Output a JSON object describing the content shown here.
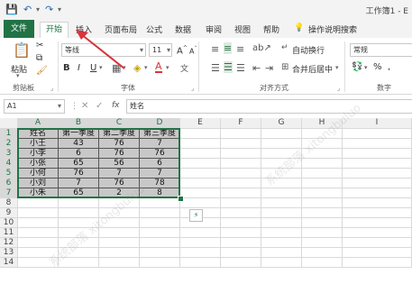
{
  "titlebar": {
    "window_title": "工作簿1 - E"
  },
  "tabs": [
    "文件",
    "开始",
    "插入",
    "页面布局",
    "公式",
    "数据",
    "审阅",
    "视图",
    "帮助"
  ],
  "tell_me": "操作说明搜索",
  "ribbon": {
    "paste": "粘贴",
    "clipboard_label": "剪贴板",
    "font_name": "等线",
    "font_size": "11",
    "bold": "B",
    "italic": "I",
    "underline": "U",
    "grow_font": "A",
    "shrink_font": "A",
    "font_label": "字体",
    "wrap_text": "自动换行",
    "merge_center": "合并后居中",
    "alignment_label": "对齐方式",
    "number_format": "常规",
    "percent": "%",
    "comma": ",",
    "number_label": "数字"
  },
  "formula_bar": {
    "name_box": "A1",
    "fx": "fx",
    "content": "姓名"
  },
  "grid": {
    "columns": [
      "A",
      "B",
      "C",
      "D",
      "E",
      "F",
      "G",
      "H",
      "I"
    ],
    "rows": [
      "1",
      "2",
      "3",
      "4",
      "5",
      "6",
      "7",
      "8",
      "9",
      "10",
      "11",
      "12",
      "13",
      "14"
    ],
    "table": [
      [
        "姓名",
        "第一季度",
        "第二季度",
        "第三季度"
      ],
      [
        "小王",
        "43",
        "76",
        "7"
      ],
      [
        "小李",
        "6",
        "76",
        "76"
      ],
      [
        "小张",
        "65",
        "56",
        "6"
      ],
      [
        "小何",
        "76",
        "7",
        "7"
      ],
      [
        "小刘",
        "7",
        "76",
        "78"
      ],
      [
        "小朱",
        "65",
        "2",
        "8"
      ]
    ]
  },
  "colors": {
    "accent": "#217346",
    "arrow": "#d8343c",
    "selection_fill": "#c8c8c8"
  },
  "icons": [
    "save-icon",
    "undo-icon",
    "redo-icon",
    "lightbulb-icon",
    "paste-icon",
    "cut-icon",
    "copy-icon",
    "format-painter-icon",
    "border-icon",
    "fill-color-icon",
    "font-color-icon",
    "phonetic-icon",
    "align-icon",
    "orientation-icon",
    "indent-icon",
    "currency-icon",
    "quick-analysis-icon"
  ]
}
